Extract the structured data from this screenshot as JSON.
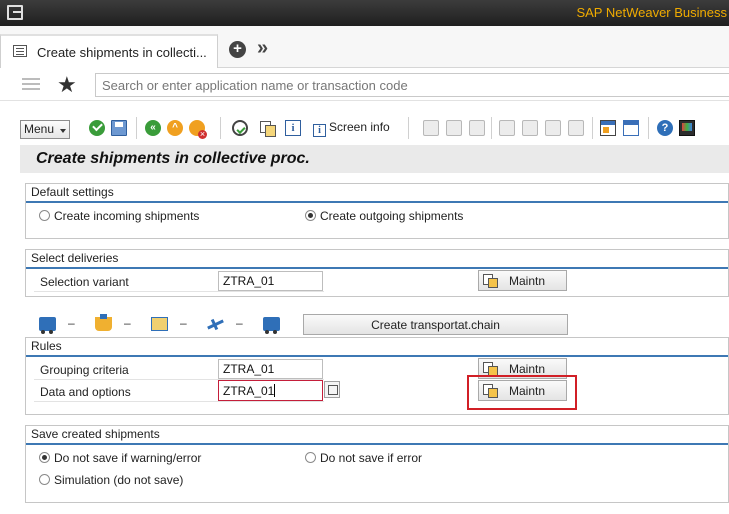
{
  "titlebar": {
    "brand": "SAP NetWeaver Business"
  },
  "tabs": {
    "active_label": "Create shipments in collecti...",
    "more": "»",
    "plus": "+"
  },
  "command": {
    "placeholder": "Search or enter application name or transaction code"
  },
  "toolbar": {
    "menu_label": "Menu",
    "screen_info_label": "Screen info"
  },
  "page": {
    "title": "Create shipments in collective proc."
  },
  "default_settings": {
    "title": "Default settings",
    "option_incoming": "Create incoming shipments",
    "option_outgoing": "Create outgoing shipments",
    "selected": "outgoing"
  },
  "select_deliveries": {
    "title": "Select deliveries",
    "selection_variant_label": "Selection variant",
    "selection_variant_value": "ZTRA_01",
    "maintain_label": "Maintn"
  },
  "transport_chain": {
    "dash": "–",
    "button_label": "Create transportat.chain"
  },
  "rules": {
    "title": "Rules",
    "grouping_label": "Grouping criteria",
    "grouping_value": "ZTRA_01",
    "grouping_maintain": "Maintn",
    "data_options_label": "Data and options",
    "data_options_value": "ZTRA_01",
    "data_options_maintain": "Maintn"
  },
  "save_shipments": {
    "title": "Save created shipments",
    "option_no_save_warning": "Do not save if warning/error",
    "option_no_save_error": "Do not save if error",
    "option_simulation": "Simulation (do not save)",
    "selected": "no_save_warning"
  },
  "colors": {
    "accent_line": "#3d78b4",
    "brand": "#f0ab00",
    "highlight": "#d11f26"
  }
}
